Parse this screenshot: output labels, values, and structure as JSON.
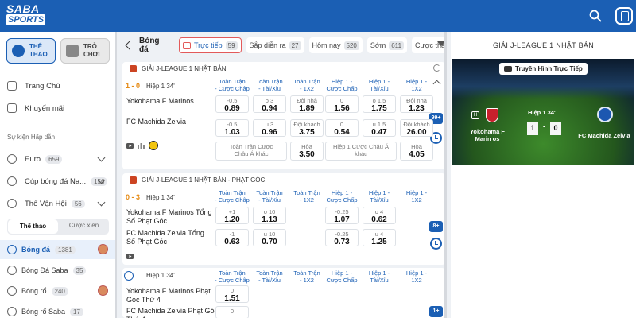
{
  "brand": {
    "line1": "SABA",
    "line2": "SPORTS"
  },
  "sidebar": {
    "tabs": [
      {
        "label": "THỂ THAO"
      },
      {
        "label": "TRÒ CHƠI"
      }
    ],
    "nav": [
      {
        "label": "Trang Chủ"
      },
      {
        "label": "Khuyến mãi"
      }
    ],
    "section_title": "Sự kiện Hấp dẫn",
    "events": [
      {
        "label": "Euro",
        "count": "659"
      },
      {
        "label": "Cúp bóng đá Na...",
        "count": "156"
      },
      {
        "label": "Thế Vận Hội",
        "count": "56"
      }
    ],
    "segment": [
      "Thể thao",
      "Cược xiên"
    ],
    "sports": [
      {
        "label": "Bóng đá",
        "count": "1381"
      },
      {
        "label": "Bóng Đá Saba",
        "count": "35"
      },
      {
        "label": "Bóng rổ",
        "count": "240"
      },
      {
        "label": "Bóng rổ Saba",
        "count": "17"
      }
    ]
  },
  "toolbar": {
    "title": "Bóng đá",
    "filters": [
      {
        "label": "Trực tiếp",
        "count": "59"
      },
      {
        "label": "Sắp diễn ra",
        "count": "27"
      },
      {
        "label": "Hôm nay",
        "count": "520"
      },
      {
        "label": "Sớm",
        "count": "611"
      },
      {
        "label": "Cược thắn",
        "count": ""
      }
    ]
  },
  "columns": [
    [
      "Toàn Trận",
      "- Cược Châp"
    ],
    [
      "Toàn Trận",
      "- Tài/Xỉu"
    ],
    [
      "Toàn Trận",
      "- 1X2"
    ],
    [
      "Hiệp 1 -",
      "Cược Chấp"
    ],
    [
      "Hiệp 1 -",
      "Tài/Xỉu"
    ],
    [
      "Hiệp 1 -",
      "1X2"
    ]
  ],
  "league1": {
    "name": "GIẢI J-LEAGUE 1 NHẬT BẢN",
    "score": "1 - 0",
    "period": "Hiệp 1 34'",
    "home": "Yokohama F Marinos",
    "away": "FC Machida Zelvia",
    "home_odds": [
      {
        "t": "-0.5",
        "v": "0.89"
      },
      {
        "t": "o 3",
        "v": "0.94"
      },
      {
        "t": "Đội nhà",
        "v": "1.89"
      },
      {
        "t": "0",
        "v": "1.56"
      },
      {
        "t": "o 1.5",
        "v": "1.75"
      },
      {
        "t": "Đội nhà",
        "v": "1.23"
      }
    ],
    "away_odds": [
      {
        "t": "-0.5",
        "v": "1.03"
      },
      {
        "t": "u 3",
        "v": "0.96"
      },
      {
        "t": "Đội khách",
        "v": "3.75"
      },
      {
        "t": "0",
        "v": "0.54"
      },
      {
        "t": "u 1.5",
        "v": "0.47"
      },
      {
        "t": "Đội khách",
        "v": "26.00"
      }
    ],
    "extra": [
      {
        "t": "Toàn Trận Cược Châu Á khác",
        "v": ""
      },
      {
        "t": "Hòa",
        "v": "3.50"
      },
      {
        "t": "Hiệp 1 Cược Châu Á khác",
        "v": ""
      },
      {
        "t": "Hòa",
        "v": "4.05"
      }
    ],
    "more": "99+"
  },
  "league2": {
    "name": "GIẢI J-LEAGUE 1 NHẬT BẢN - PHẠT GÓC",
    "score": "0 - 3",
    "period": "Hiệp 1 34'",
    "home": "Yokohama F Marinos Tổng Số Phạt Góc",
    "away": "FC Machida Zelvia Tổng Số Phạt Góc",
    "home_odds": [
      {
        "t": "+1",
        "v": "1.20"
      },
      {
        "t": "o 10",
        "v": "1.13"
      },
      {
        "t": "-0.25",
        "v": "1.07"
      },
      {
        "t": "o 4",
        "v": "0.62"
      }
    ],
    "away_odds": [
      {
        "t": "-1",
        "v": "0.63"
      },
      {
        "t": "u 10",
        "v": "0.70"
      },
      {
        "t": "-0.25",
        "v": "0.73"
      },
      {
        "t": "u 4",
        "v": "1.25"
      }
    ],
    "more": "8+"
  },
  "league3": {
    "period": "Hiệp 1 34'",
    "home": "Yokohama F Marinos Phạt Góc Thứ 4",
    "away": "FC Machida Zelvia Phạt Góc Thứ 4",
    "home_odds": [
      {
        "t": "0",
        "v": "1.51"
      }
    ],
    "away_odds": [
      {
        "t": "0",
        "v": ""
      }
    ],
    "more": "1+"
  },
  "right_panel": {
    "title": "GIẢI J-LEAGUE 1 NHẬT BẢN",
    "tv_label": "Truyền Hình Trực Tiếp",
    "period": "Hiệp 1 34'",
    "home_score": "1",
    "away_score": "0",
    "home_team": "Yokohama F Marin os",
    "away_team": "FC Machida Zelvia"
  },
  "colors": {
    "primary": "#1b5fb4",
    "score": "#e58a14",
    "live": "#e35a5a"
  }
}
